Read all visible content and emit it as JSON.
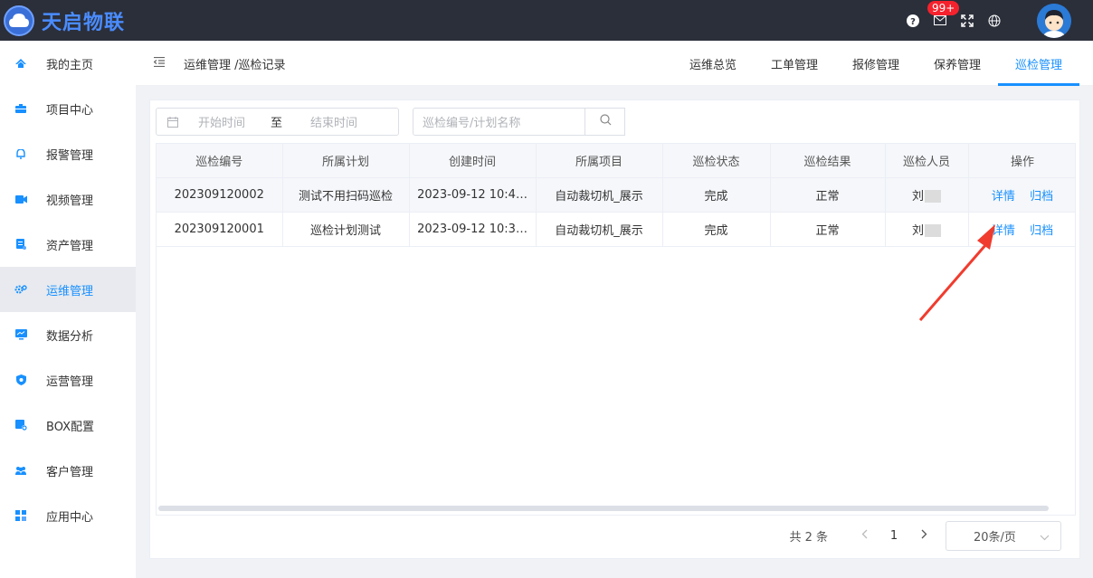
{
  "header": {
    "brand": "天启物联",
    "badge": "99+",
    "icons": [
      "help-icon",
      "mail-icon",
      "fullscreen-icon",
      "language-icon"
    ]
  },
  "sidebar": {
    "items": [
      {
        "label": "我的主页",
        "icon": "home-icon"
      },
      {
        "label": "项目中心",
        "icon": "project-icon"
      },
      {
        "label": "报警管理",
        "icon": "bell-icon"
      },
      {
        "label": "视频管理",
        "icon": "video-icon"
      },
      {
        "label": "资产管理",
        "icon": "asset-icon"
      },
      {
        "label": "运维管理",
        "icon": "gear-icon",
        "active": true
      },
      {
        "label": "数据分析",
        "icon": "monitor-icon"
      },
      {
        "label": "运营管理",
        "icon": "shield-icon"
      },
      {
        "label": "BOX配置",
        "icon": "box-icon"
      },
      {
        "label": "客户管理",
        "icon": "users-icon"
      },
      {
        "label": "应用中心",
        "icon": "apps-icon"
      }
    ]
  },
  "breadcrumb": "运维管理 /巡检记录",
  "tabs": [
    {
      "label": "运维总览"
    },
    {
      "label": "工单管理"
    },
    {
      "label": "报修管理"
    },
    {
      "label": "保养管理"
    },
    {
      "label": "巡检管理",
      "active": true
    }
  ],
  "filters": {
    "start_placeholder": "开始时间",
    "separator": "至",
    "end_placeholder": "结束时间",
    "search_placeholder": "巡检编号/计划名称"
  },
  "table": {
    "columns": [
      "巡检编号",
      "所属计划",
      "创建时间",
      "所属项目",
      "巡检状态",
      "巡检结果",
      "巡检人员",
      "操作"
    ],
    "rows": [
      {
        "id": "202309120002",
        "plan": "测试不用扫码巡检",
        "created": "2023-09-12 10:4…",
        "project": "自动裁切机_展示",
        "status": "完成",
        "result": "正常",
        "person": "刘"
      },
      {
        "id": "202309120001",
        "plan": "巡检计划测试",
        "created": "2023-09-12 10:3…",
        "project": "自动裁切机_展示",
        "status": "完成",
        "result": "正常",
        "person": "刘"
      }
    ],
    "actions": {
      "detail": "详情",
      "archive": "归档"
    }
  },
  "pagination": {
    "total": "共 2 条",
    "current": "1",
    "page_size": "20条/页"
  },
  "colors": {
    "accent": "#1890ff",
    "header_bg": "#2b2f3a",
    "badge": "#f5222d",
    "arrow": "#f03c2e"
  }
}
